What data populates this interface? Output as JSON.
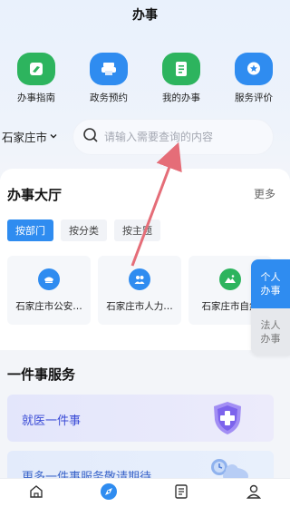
{
  "header": {
    "title": "办事"
  },
  "quick_actions": [
    {
      "label": "办事指南",
      "icon": "guide-book-icon",
      "color": "#2db45e"
    },
    {
      "label": "政务预约",
      "icon": "printer-icon",
      "color": "#2f8cf0"
    },
    {
      "label": "我的办事",
      "icon": "document-list-icon",
      "color": "#2db45e"
    },
    {
      "label": "服务评价",
      "icon": "star-chat-icon",
      "color": "#2f8cf0"
    }
  ],
  "location": {
    "city": "石家庄市"
  },
  "search": {
    "placeholder": "请输入需要查询的内容"
  },
  "hall": {
    "title": "办事大厅",
    "more": "更多",
    "tabs": [
      "按部门",
      "按分类",
      "按主题"
    ],
    "active_tab": "按部门",
    "departments": [
      {
        "label": "石家庄市公安…",
        "icon": "police-cap-icon",
        "color": "#2f8cf0"
      },
      {
        "label": "石家庄市人力…",
        "icon": "people-icon",
        "color": "#2f8cf0"
      },
      {
        "label": "石家庄市自然",
        "icon": "mountain-icon",
        "color": "#2db45e"
      }
    ]
  },
  "side_switch": {
    "personal": "个人办事",
    "legal": "法人办事"
  },
  "services": {
    "title": "一件事服务",
    "items": [
      "就医一件事",
      "更多一件事服务敬请期待"
    ]
  },
  "bottom_nav": [
    "home-icon",
    "compass-icon",
    "document-icon",
    "user-icon"
  ],
  "colors": {
    "primary": "#2f8cf0",
    "green": "#2db45e",
    "annotation_arrow": "#e56d78"
  }
}
